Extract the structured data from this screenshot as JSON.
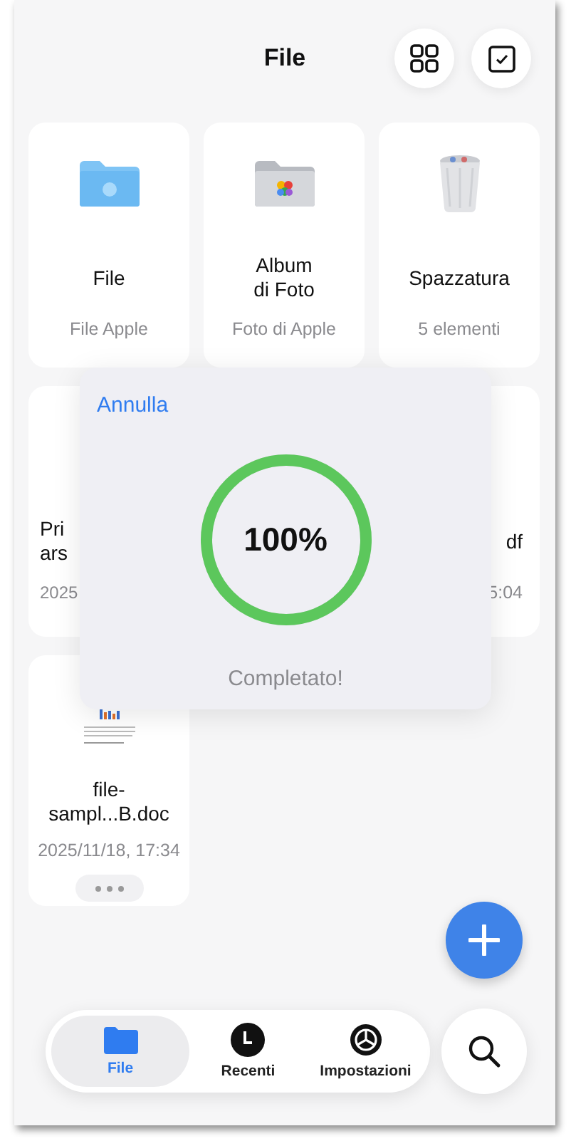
{
  "header": {
    "title": "File",
    "actions": [
      {
        "kind": "grid"
      },
      {
        "kind": "select"
      }
    ]
  },
  "locations": [
    {
      "kind": "folder",
      "name_lines": [
        "File"
      ],
      "subtitle": "File Apple"
    },
    {
      "kind": "photos",
      "name_lines": [
        "Album",
        "di Foto"
      ],
      "subtitle": "Foto di Apple"
    },
    {
      "kind": "trash",
      "name_lines": [
        "Spazzatura"
      ],
      "subtitle": "5 elementi"
    }
  ],
  "files": [
    {
      "kind": "clipped-left",
      "name_lines": [
        "Pri",
        "ars"
      ],
      "date": "2025"
    },
    {
      "kind": "clipped-right",
      "name_lines": [
        "df"
      ],
      "date": "5:04"
    },
    {
      "kind": "file",
      "name_lines": [
        "file-",
        "sampl...B.doc"
      ],
      "date": "2025/11/18, 17:34"
    }
  ],
  "dialog": {
    "cancel": "Annulla",
    "level": 1,
    "percent": "100%",
    "status": "Completato!"
  },
  "tabs": [
    {
      "kind": "folder",
      "label": "File",
      "selected": true
    },
    {
      "kind": "clock",
      "label": "Recenti",
      "selected": false
    },
    {
      "kind": "gear",
      "label": "Impostazioni",
      "selected": false
    }
  ]
}
